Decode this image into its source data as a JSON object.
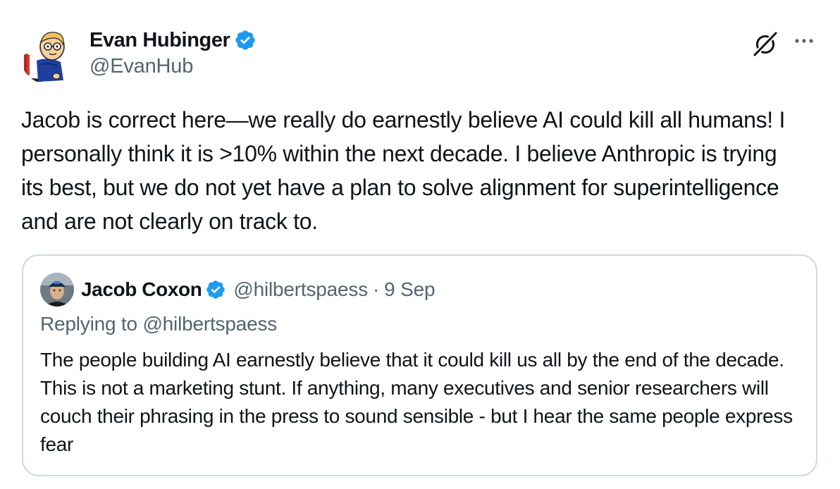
{
  "tweet": {
    "author": {
      "name": "Evan Hubinger",
      "handle": "@EvanHub",
      "verified": true,
      "avatar_icon": "cartoon-avatar-icon"
    },
    "text": "Jacob is correct here—we really do earnestly believe AI could kill all humans! I personally think it is >10% within the next decade. I believe Anthropic is trying its best, but we do not yet have a plan to solve alignment for superintelligence and are not clearly on track to.",
    "actions": {
      "grok_icon": "grok-icon",
      "more_icon": "more-options-icon"
    }
  },
  "quoted_tweet": {
    "author": {
      "name": "Jacob Coxon",
      "handle": "@hilbertspaess",
      "verified": true,
      "avatar_icon": "profile-photo-icon"
    },
    "separator": "·",
    "date": "9 Sep",
    "replying_to": "Replying to @hilbertspaess",
    "text": "The people building AI earnestly believe that it could kill us all by the end of the decade. This is not a marketing stunt. If anything, many executives and senior researchers will couch their phrasing in the press to sound sensible - but I hear the same people express fear"
  },
  "colors": {
    "text_primary": "#0f1419",
    "text_secondary": "#536471",
    "verified_blue": "#1d9bf0",
    "border": "#cfd9de"
  }
}
